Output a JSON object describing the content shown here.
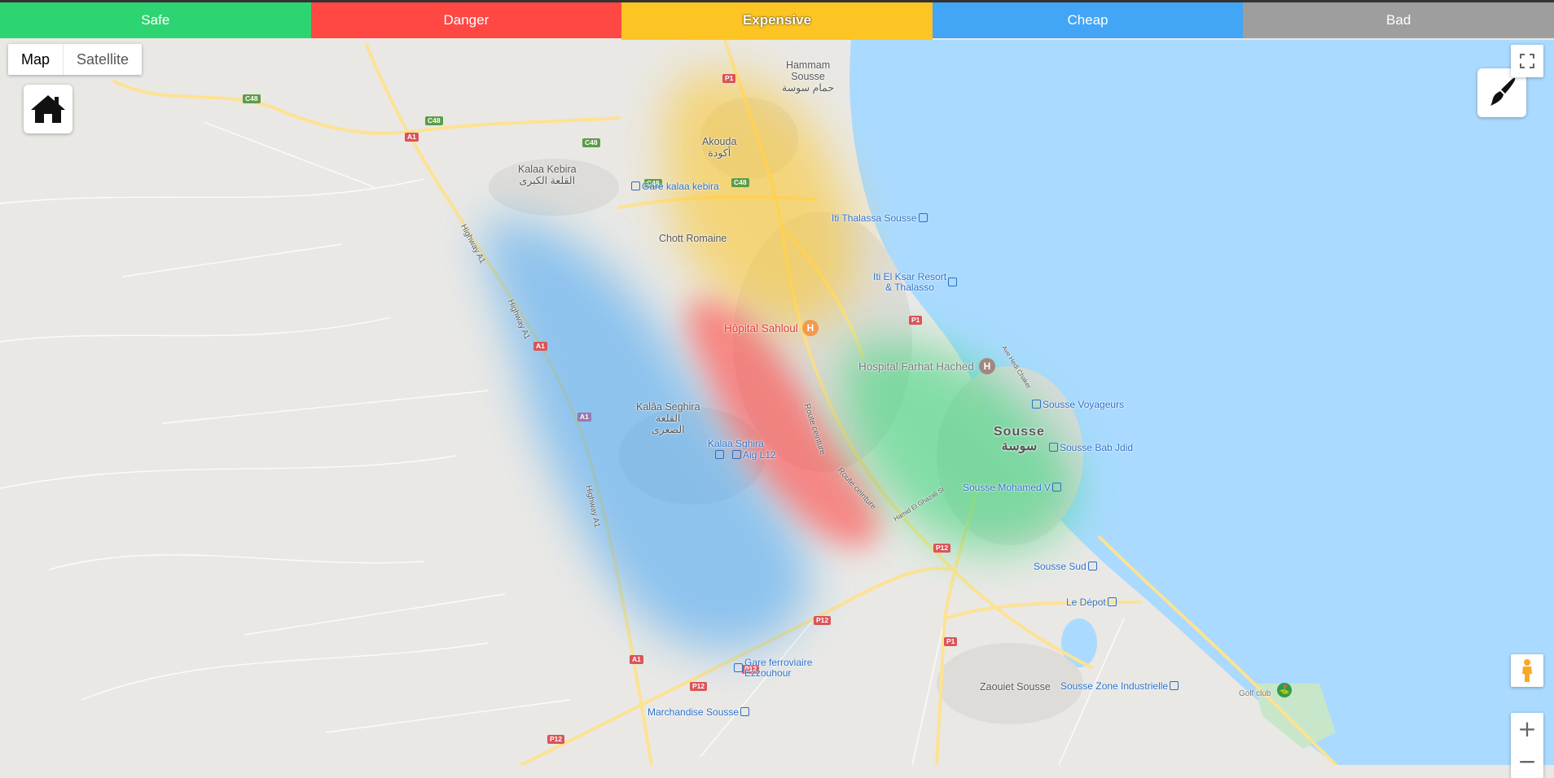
{
  "tabs": [
    {
      "label": "Safe",
      "color": "#2dd472",
      "active": false
    },
    {
      "label": "Danger",
      "color": "#ff4744",
      "active": false
    },
    {
      "label": "Expensive",
      "color": "#fdc523",
      "active": true
    },
    {
      "label": "Cheap",
      "color": "#42a5f5",
      "active": false
    },
    {
      "label": "Bad",
      "color": "#9e9e9e",
      "active": false
    }
  ],
  "map_type": {
    "map": "Map",
    "satellite": "Satellite",
    "selected": "Map"
  },
  "controls": {
    "zoom_in": "+",
    "zoom_out": "−",
    "fullscreen_icon": "fullscreen-icon",
    "pegman_icon": "pegman-icon",
    "home_icon": "home-icon",
    "brush_icon": "paint-brush-icon"
  },
  "places": {
    "hammam_sousse": "Hammam\nSousse\nحمام سوسة",
    "akouda": "Akouda\nأكودة",
    "kalaa_kebira": "Kalaa Kebira\nالقلعة الكبرى",
    "chott_romaine": "Chott Romaine",
    "kalaa_seghira": "Kalâa Seghira\nالقلعة\nالصغرى",
    "sousse_en": "Sousse",
    "sousse_ar": "سوسة",
    "zaouiet_sousse": "Zaouiet Sousse"
  },
  "transit": {
    "gare_kalaa_kebira": "Gare kalaa kebira",
    "iti_thalassa": "Iti Thalassa Sousse",
    "iti_el_ksar": "Iti El Ksar Resort\n& Thalasso",
    "kalaa_sghira": "Kalaa Sghira",
    "aig_l12": "Aig L12",
    "sousse_voyageurs": "Sousse Voyageurs",
    "sousse_bab_jdid": "Sousse Bab Jdid",
    "sousse_mohamed_v": "Sousse Mohamed V",
    "sousse_sud": "Sousse Sud",
    "le_depot": "Le Dépot",
    "gare_ezzouhour": "Gare ferroviaire\nEzzouhour",
    "marchandise_sousse": "Marchandise Sousse",
    "zone_industrielle": "Sousse Zone Industrielle"
  },
  "poi": {
    "hopital_sahloul": "Hôpital Sahloul",
    "hospital_farhat": "Hospital Farhat Hached",
    "golf_club": "Golf club",
    "hospital_pin": "H"
  },
  "roads": {
    "highway_a1_a": "Highway A1",
    "highway_a1_b": "Highway A1",
    "highway_a1_c": "Highway A1",
    "route_ceinture_a": "Route ceinture",
    "route_ceinture_b": "Route ceinture",
    "hamid_el_ghazali": "Hamid El Ghazali St",
    "ave_hedi_chaker": "Ave Hedi Chaker",
    "a1": "A1",
    "c48": "C48",
    "p1": "P1",
    "p12": "P12"
  },
  "heat_colors": {
    "expensive": "#fdc523",
    "danger": "#ff4744",
    "safe": "#2dd472",
    "cheap": "#42a5f5",
    "sea": "#aadaff"
  }
}
